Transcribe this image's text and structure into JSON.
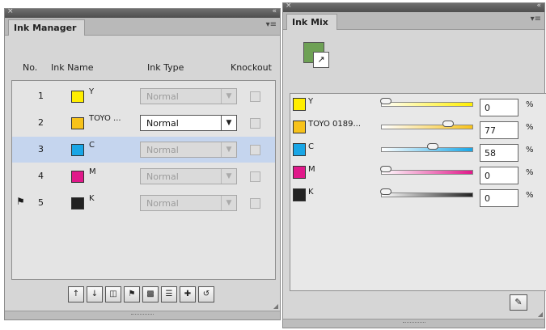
{
  "ink_manager": {
    "title": "Ink Manager",
    "columns": {
      "no": "No.",
      "ink_name": "Ink Name",
      "ink_type": "Ink Type",
      "knockout": "Knockout"
    },
    "rows": [
      {
        "no": "1",
        "name": "Y",
        "color": "#ffee00",
        "type": "Normal"
      },
      {
        "no": "2",
        "name": "TOYO ...",
        "color": "#f7c21a",
        "type": "Normal"
      },
      {
        "no": "3",
        "name": "C",
        "color": "#19a6e6",
        "type": "Normal"
      },
      {
        "no": "4",
        "name": "M",
        "color": "#e0198a",
        "type": "Normal"
      },
      {
        "no": "5",
        "name": "K",
        "color": "#222222",
        "type": "Normal"
      }
    ],
    "selected_row": "3",
    "toolbar_icons": [
      "move-up-icon",
      "move-down-icon",
      "duplicate-icon",
      "print-icon",
      "chart-icon",
      "list-icon",
      "add-ink-icon",
      "convert-icon"
    ]
  },
  "ink_mix": {
    "title": "Ink Mix",
    "mix_color": "#6ea155",
    "inks": [
      {
        "name": "Y",
        "color": "#ffee00",
        "value": "0",
        "fraction": 0.0
      },
      {
        "name": "TOYO 0189...",
        "color": "#f7c21a",
        "value": "77",
        "fraction": 0.77
      },
      {
        "name": "C",
        "color": "#19a6e6",
        "value": "58",
        "fraction": 0.58
      },
      {
        "name": "M",
        "color": "#e0198a",
        "value": "0",
        "fraction": 0.0
      },
      {
        "name": "K",
        "color": "#222222",
        "value": "0",
        "fraction": 0.0
      }
    ],
    "percent_sign": "%"
  },
  "icons": {
    "close": "×",
    "collapse": "«",
    "menu": "▾≡"
  }
}
